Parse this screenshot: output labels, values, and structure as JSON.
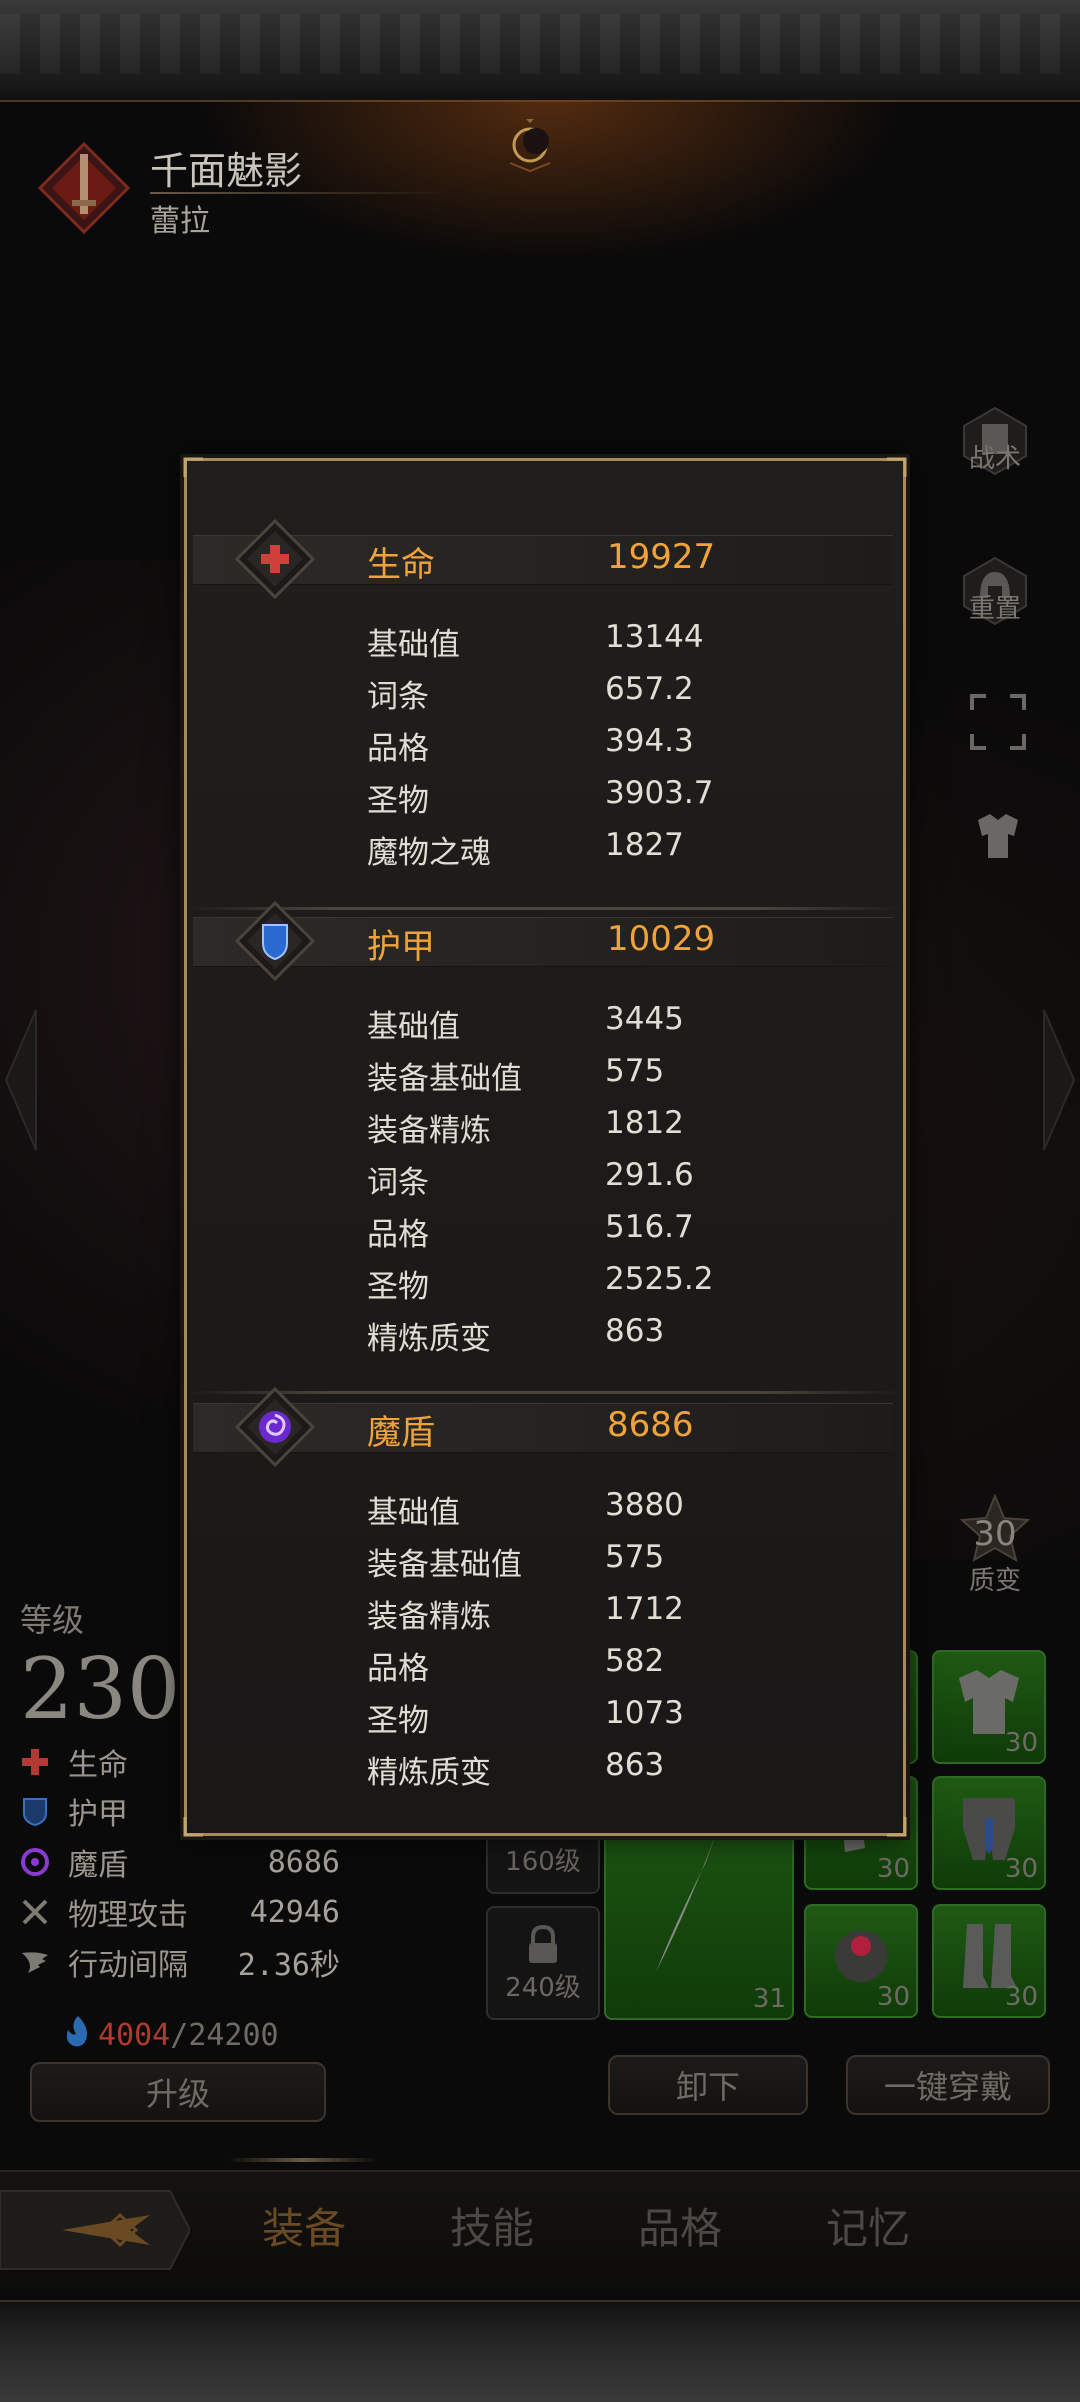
{
  "hero": {
    "name": "千面魅影",
    "subtitle": "蕾拉"
  },
  "side_buttons": [
    {
      "label": "战术",
      "icon": "banner-icon"
    },
    {
      "label": "重置",
      "icon": "helmet-icon"
    },
    {
      "label": "",
      "icon": "fullscreen-icon"
    },
    {
      "label": "",
      "icon": "armor-icon"
    },
    {
      "label": "质变",
      "icon": "star-badge-icon",
      "value": "30"
    }
  ],
  "level": {
    "label": "等级",
    "value": "230"
  },
  "stats": [
    {
      "label": "生命",
      "value": "19927",
      "icon": "health-cross-icon",
      "color": "#c0393a"
    },
    {
      "label": "护甲",
      "value": "10029",
      "icon": "armor-shield-icon",
      "color": "#3a6fc4"
    },
    {
      "label": "魔盾",
      "value": "8686",
      "icon": "magic-shield-icon",
      "color": "#8a3ad0"
    },
    {
      "label": "物理攻击",
      "value": "42946",
      "icon": "crossed-swords-icon",
      "color": "#8a8680"
    },
    {
      "label": "行动间隔",
      "value": "2.36秒",
      "icon": "wing-icon",
      "color": "#8a8680"
    }
  ],
  "exp": {
    "current": "4004",
    "separator": "/",
    "max": "24200"
  },
  "buttons": {
    "upgrade": "升级",
    "unequip": "卸下",
    "equip_all": "一键穿戴"
  },
  "slots": {
    "locked": [
      "160级",
      "240级"
    ],
    "weapon_level": "31",
    "gear_levels": [
      "30",
      "30",
      "30",
      "30",
      "30",
      "30"
    ]
  },
  "nav": {
    "tabs": [
      "装备",
      "技能",
      "品格",
      "记忆"
    ],
    "active": "装备"
  },
  "popup": {
    "sections": [
      {
        "title": "生命",
        "total": "19927",
        "icon": "health-cross-icon",
        "rows": [
          {
            "label": "基础值",
            "value": "13144"
          },
          {
            "label": "词条",
            "value": "657.2"
          },
          {
            "label": "品格",
            "value": "394.3"
          },
          {
            "label": "圣物",
            "value": "3903.7"
          },
          {
            "label": "魔物之魂",
            "value": "1827"
          }
        ]
      },
      {
        "title": "护甲",
        "total": "10029",
        "icon": "armor-shield-icon",
        "rows": [
          {
            "label": "基础值",
            "value": "3445"
          },
          {
            "label": "装备基础值",
            "value": "575"
          },
          {
            "label": "装备精炼",
            "value": "1812"
          },
          {
            "label": "词条",
            "value": "291.6"
          },
          {
            "label": "品格",
            "value": "516.7"
          },
          {
            "label": "圣物",
            "value": "2525.2"
          },
          {
            "label": "精炼质变",
            "value": "863"
          }
        ]
      },
      {
        "title": "魔盾",
        "total": "8686",
        "icon": "magic-shield-icon",
        "rows": [
          {
            "label": "基础值",
            "value": "3880"
          },
          {
            "label": "装备基础值",
            "value": "575"
          },
          {
            "label": "装备精炼",
            "value": "1712"
          },
          {
            "label": "品格",
            "value": "582"
          },
          {
            "label": "圣物",
            "value": "1073"
          },
          {
            "label": "精炼质变",
            "value": "863"
          }
        ]
      }
    ]
  },
  "colors": {
    "accent": "#f2a23a",
    "border": "#a68a5e",
    "text": "#e2ddd4",
    "slot_green": "#1f5a14",
    "exp_current": "#b03a30"
  }
}
